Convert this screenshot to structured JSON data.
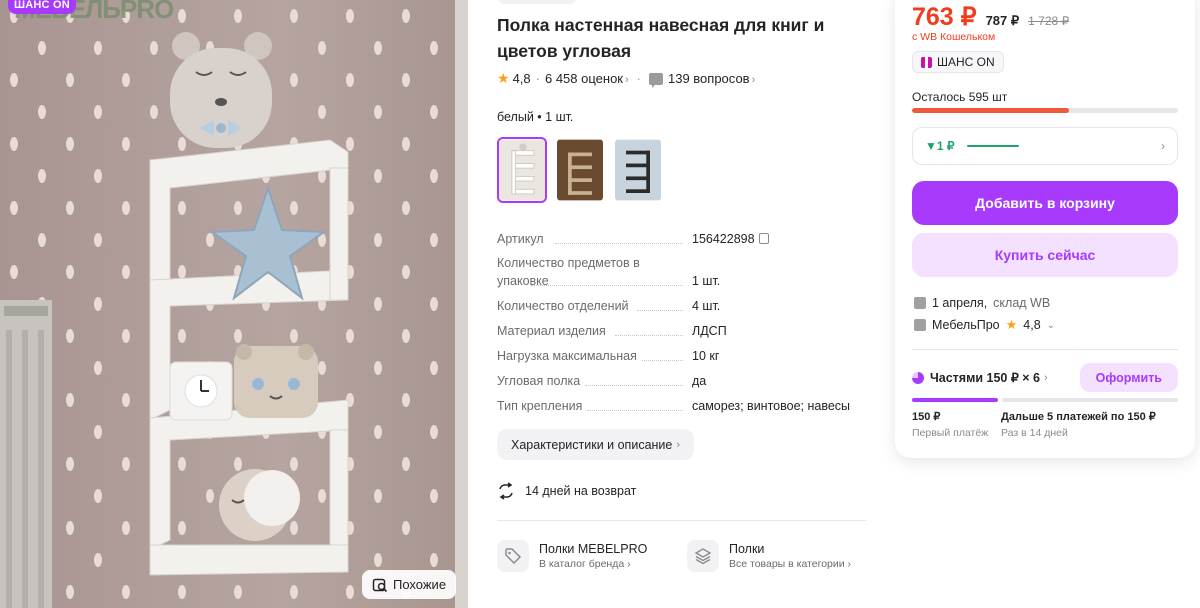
{
  "image": {
    "badge": "ШАНС ON",
    "logo_text": "МЕБЕЛЬPRO",
    "similar_label": "Похожие"
  },
  "product": {
    "title": "Полка настенная навесная для книг и цветов угловая",
    "rating": "4,8",
    "reviews": "6 458 оценок",
    "questions": "139 вопросов",
    "variant_label": "белый • 1 шт.",
    "thumbnails": [
      {
        "name": "white-shelf-thumbnail",
        "color": "#f0ebe6"
      },
      {
        "name": "wood-shelf-thumbnail",
        "color": "#6b4a32"
      },
      {
        "name": "black-shelf-thumbnail",
        "color": "#c7d3dd"
      }
    ]
  },
  "specs": [
    {
      "key": "Артикул",
      "value": "156422898",
      "copy": true
    },
    {
      "key": "Количество предметов в упаковке",
      "value": "1 шт."
    },
    {
      "key": "Количество отделений",
      "value": "4 шт."
    },
    {
      "key": "Материал изделия",
      "value": "ЛДСП"
    },
    {
      "key": "Нагрузка максимальная",
      "value": "10 кг"
    },
    {
      "key": "Угловая полка",
      "value": "да"
    },
    {
      "key": "Тип крепления",
      "value": "саморез; винтовое; навесы"
    }
  ],
  "chars_button": "Характеристики и описание",
  "return_text": "14 дней на возврат",
  "links": [
    {
      "title": "Полки MEBELPRO",
      "sub": "В каталог бренда"
    },
    {
      "title": "Полки",
      "sub": "Все товары в категории"
    }
  ],
  "price": {
    "main": "763 ₽",
    "old": "787 ₽",
    "strike": "1 728 ₽",
    "wallet_note": "с WB Кошельком",
    "chance_label": "ШАНС ON",
    "stock_text": "Осталось 595 шт",
    "stock_fraction": 0.59,
    "delta_value": "▼1 ₽",
    "add_to_cart": "Добавить в корзину",
    "buy_now": "Купить сейчас",
    "delivery_date": "1 апреля,",
    "delivery_store": "склад WB",
    "seller_name": "МебельПро",
    "seller_rating": "4,8",
    "parts_title": "Частями 150 ₽ × 6",
    "order_button": "Оформить",
    "first_payment_amount": "150 ₽",
    "first_payment_label": "Первый платёж",
    "next_payments_amount": "Дальше 5 платежей по 150 ₽",
    "next_payments_label": "Раз в 14 дней"
  },
  "colors": {
    "accent": "#a73afd",
    "accent_light": "#f3e1ff",
    "price_red": "#f23c20",
    "green": "#21a46c",
    "rating_star": "#ff9e1b"
  }
}
